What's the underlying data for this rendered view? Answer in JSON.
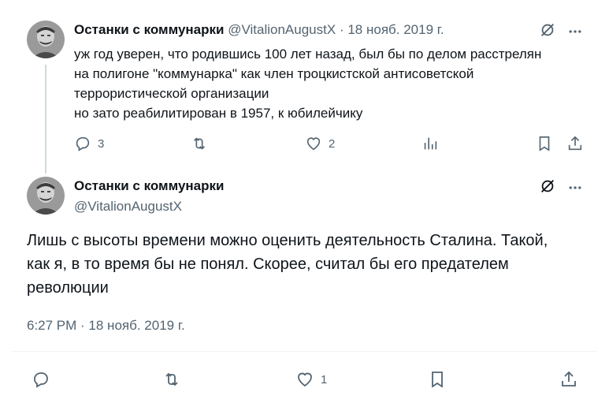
{
  "colors": {
    "text": "#0f1419",
    "muted": "#536471",
    "line": "#cfd9de"
  },
  "tweet1": {
    "author_name": "Останки с коммунарки",
    "handle": "@VitalionAugustX",
    "separator": "·",
    "date": "18 нояб. 2019 г.",
    "text_lines": [
      "уж год уверен, что родившись 100 лет назад, был бы по делом расстрелян",
      "на полигоне \"коммунарка\" как член троцкистской антисоветской",
      "террористической организации",
      "но зато реабилитирован в 1957, к юбилейчику"
    ],
    "actions": {
      "replies": "3",
      "reposts": "",
      "likes": "2"
    }
  },
  "tweet2": {
    "author_name": "Останки с коммунарки",
    "handle": "@VitalionAugustX",
    "text_lines": [
      "Лишь с высоты времени можно оценить деятельность Сталина. Такой,",
      "как я, в то время бы не понял. Скорее, считал бы его предателем",
      "революции"
    ],
    "timestamp": "6:27 PM · 18 нояб. 2019 г.",
    "actions": {
      "replies": "",
      "reposts": "",
      "likes": "1"
    }
  },
  "icons": [
    "grok-icon",
    "more-icon",
    "reply-icon",
    "repost-icon",
    "like-icon",
    "views-icon",
    "bookmark-icon",
    "share-icon"
  ]
}
